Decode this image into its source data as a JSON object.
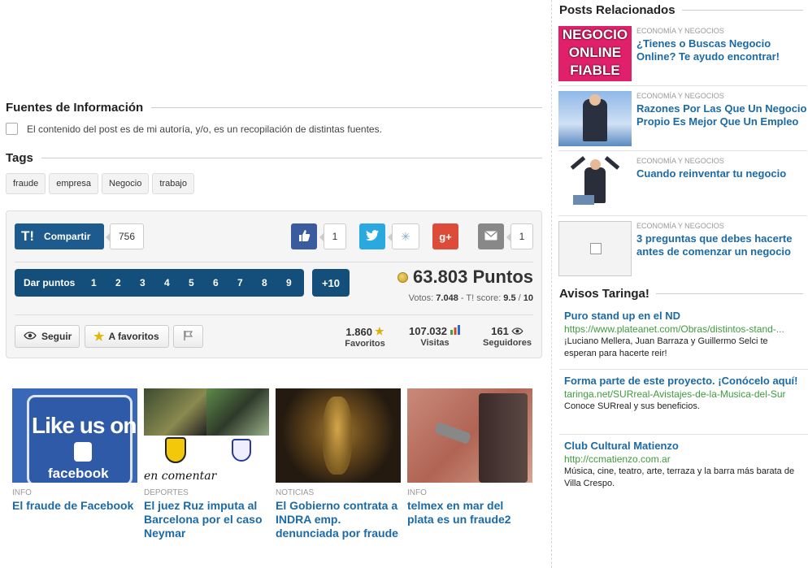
{
  "fuentes": {
    "title": "Fuentes de Información",
    "checkbox_label": "El contenido del post es de mi autoría, y/o, es un recopilación de distintas fuentes."
  },
  "tags": {
    "title": "Tags",
    "items": [
      "fraude",
      "empresa",
      "Negocio",
      "trabajo"
    ]
  },
  "share": {
    "logo": "T!",
    "label": "Compartir",
    "count": "756",
    "facebook_count": "1",
    "gplus_label": "g+",
    "email_count": "1"
  },
  "points": {
    "label": "Dar puntos",
    "values": [
      "1",
      "2",
      "3",
      "4",
      "5",
      "6",
      "7",
      "8",
      "9"
    ],
    "plus10": "+10",
    "total": "63.803 Puntos",
    "votes_label": "Votos:",
    "votes": "7.048",
    "score_label": "- T! score:",
    "score": "9.5",
    "score_sep": "/",
    "score_max": "10"
  },
  "actions": {
    "follow": "Seguir",
    "favorite": "A favoritos"
  },
  "stats": {
    "favoritos": {
      "value": "1.860",
      "label": "Favoritos"
    },
    "visitas": {
      "value": "107.032",
      "label": "Visitas"
    },
    "seguidores": {
      "value": "161",
      "label": "Seguidores"
    }
  },
  "cards": [
    {
      "cat": "INFO",
      "title": "El fraude de Facebook",
      "img_text": "Like us on",
      "img_text2": "facebook"
    },
    {
      "cat": "DEPORTES",
      "title": "El juez Ruz imputa al Barcelona por el caso Neymar",
      "img_text": "en comentar"
    },
    {
      "cat": "NOTICIAS",
      "title": "El Gobierno contrata a INDRA emp. denunciada por fraude"
    },
    {
      "cat": "INFO",
      "title": "telmex en mar del plata es un fraude2"
    }
  ],
  "sidebar": {
    "related_title": "Posts Relacionados",
    "related": [
      {
        "cat": "ECONOMÍA Y NEGOCIOS",
        "title": "¿Tienes o Buscas Negocio Online? Te ayudo encontrar!",
        "img_text": "NEGOCIO ONLINE FIABLE"
      },
      {
        "cat": "ECONOMÍA Y NEGOCIOS",
        "title": "Razones Por Las Que Un Negocio Propio Es Mejor Que Un Empleo"
      },
      {
        "cat": "ECONOMÍA Y NEGOCIOS",
        "title": "Cuando reinventar tu negocio"
      },
      {
        "cat": "ECONOMÍA Y NEGOCIOS",
        "title": "3 preguntas que debes hacerte antes de comenzar un negocio"
      }
    ],
    "ads_title": "Avisos Taringa!",
    "ads": [
      {
        "title": "Puro stand up en el ND",
        "url": "https://www.plateanet.com/Obras/distintos-stand-...",
        "desc": "¡Luciano Mellera, Juan Barraza y Guillermo Selci te esperan para hacerte reir!"
      },
      {
        "title": "Forma parte de este proyecto. ¡Conócelo aquí!",
        "url": "taringa.net/SURreal-Avistajes-de-la-Musica-del-Sur",
        "desc": "Conoce SURreal y sus beneficios."
      },
      {
        "title": "Club Cultural Matienzo",
        "url": "http://ccmatienzo.com.ar",
        "desc": "Música, cine, teatro, arte, terraza y la barra más barata de Villa Crespo."
      }
    ]
  }
}
